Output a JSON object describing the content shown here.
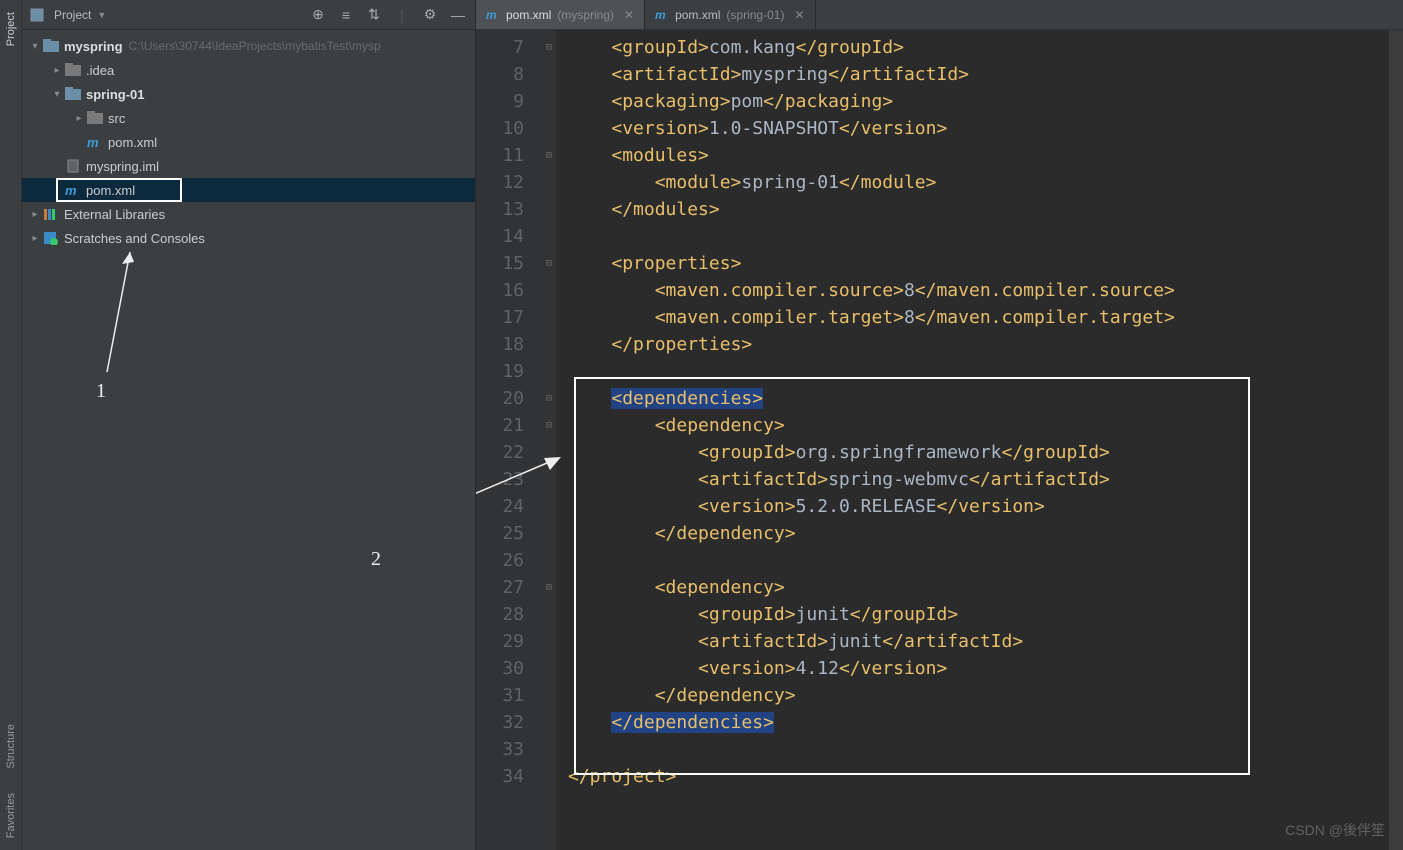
{
  "leftStripe": {
    "project": "Project",
    "structure": "Structure",
    "favorites": "Favorites"
  },
  "sidebar": {
    "title": "Project",
    "tools": {
      "add": "⊕",
      "t2": "≡",
      "t3": "⇅",
      "gear": "⚙",
      "minus": "—"
    },
    "tree": {
      "root": {
        "label": "myspring",
        "path": "C:\\Users\\30744\\IdeaProjects\\mybatisTest\\mysp"
      },
      "idea": ".idea",
      "module": "spring-01",
      "src": "src",
      "modPom": "pom.xml",
      "iml": "myspring.iml",
      "rootPom": "pom.xml",
      "ext": "External Libraries",
      "scratch": "Scratches and Consoles"
    },
    "annot1": "1"
  },
  "tabs": [
    {
      "file": "pom.xml",
      "ctx": "(myspring)",
      "active": true
    },
    {
      "file": "pom.xml",
      "ctx": "(spring-01)",
      "active": false
    }
  ],
  "annot2": "2",
  "watermark": "CSDN @後伴笙",
  "code": {
    "startLine": 7,
    "lines": [
      {
        "n": 7,
        "fold": "-",
        "ind": 1,
        "seg": [
          [
            "t",
            "<groupId>"
          ],
          [
            "x",
            "com.kang"
          ],
          [
            "t",
            "</groupId>"
          ]
        ]
      },
      {
        "n": 8,
        "fold": "",
        "ind": 1,
        "seg": [
          [
            "t",
            "<artifactId>"
          ],
          [
            "x",
            "myspring"
          ],
          [
            "t",
            "</artifactId>"
          ]
        ]
      },
      {
        "n": 9,
        "fold": "",
        "ind": 1,
        "seg": [
          [
            "t",
            "<packaging>"
          ],
          [
            "x",
            "pom"
          ],
          [
            "t",
            "</packaging>"
          ]
        ]
      },
      {
        "n": 10,
        "fold": "",
        "ind": 1,
        "seg": [
          [
            "t",
            "<version>"
          ],
          [
            "x",
            "1.0-SNAPSHOT"
          ],
          [
            "t",
            "</version>"
          ]
        ]
      },
      {
        "n": 11,
        "fold": "-",
        "ind": 1,
        "seg": [
          [
            "t",
            "<modules>"
          ]
        ]
      },
      {
        "n": 12,
        "fold": "",
        "ind": 2,
        "seg": [
          [
            "t",
            "<module>"
          ],
          [
            "x",
            "spring-01"
          ],
          [
            "t",
            "</module>"
          ]
        ]
      },
      {
        "n": 13,
        "fold": "",
        "ind": 1,
        "seg": [
          [
            "t",
            "</modules>"
          ]
        ]
      },
      {
        "n": 14,
        "fold": "",
        "ind": 0,
        "seg": []
      },
      {
        "n": 15,
        "fold": "-",
        "ind": 1,
        "seg": [
          [
            "t",
            "<properties>"
          ]
        ]
      },
      {
        "n": 16,
        "fold": "",
        "ind": 2,
        "seg": [
          [
            "t",
            "<maven.compiler.source>"
          ],
          [
            "x",
            "8"
          ],
          [
            "t",
            "</maven.compiler.source>"
          ]
        ]
      },
      {
        "n": 17,
        "fold": "",
        "ind": 2,
        "seg": [
          [
            "t",
            "<maven.compiler.target>"
          ],
          [
            "x",
            "8"
          ],
          [
            "t",
            "</maven.compiler.target>"
          ]
        ]
      },
      {
        "n": 18,
        "fold": "",
        "ind": 1,
        "seg": [
          [
            "t",
            "</properties>"
          ]
        ]
      },
      {
        "n": 19,
        "fold": "",
        "ind": 0,
        "seg": []
      },
      {
        "n": 20,
        "fold": "-",
        "ind": 1,
        "seg": [
          [
            "th",
            "<dependencies>"
          ]
        ]
      },
      {
        "n": 21,
        "fold": "-",
        "ind": 2,
        "seg": [
          [
            "t",
            "<dependency>"
          ]
        ]
      },
      {
        "n": 22,
        "fold": "",
        "ind": 3,
        "seg": [
          [
            "t",
            "<groupId>"
          ],
          [
            "x",
            "org.springframework"
          ],
          [
            "t",
            "</groupId>"
          ]
        ]
      },
      {
        "n": 23,
        "fold": "",
        "ind": 3,
        "seg": [
          [
            "t",
            "<artifactId>"
          ],
          [
            "x",
            "spring-webmvc"
          ],
          [
            "t",
            "</artifactId>"
          ]
        ]
      },
      {
        "n": 24,
        "fold": "",
        "ind": 3,
        "seg": [
          [
            "t",
            "<version>"
          ],
          [
            "x",
            "5.2.0.RELEASE"
          ],
          [
            "t",
            "</version>"
          ]
        ]
      },
      {
        "n": 25,
        "fold": "",
        "ind": 2,
        "seg": [
          [
            "t",
            "</dependency>"
          ]
        ]
      },
      {
        "n": 26,
        "fold": "",
        "ind": 0,
        "seg": []
      },
      {
        "n": 27,
        "fold": "-",
        "ind": 2,
        "seg": [
          [
            "t",
            "<dependency>"
          ]
        ]
      },
      {
        "n": 28,
        "fold": "",
        "ind": 3,
        "seg": [
          [
            "t",
            "<groupId>"
          ],
          [
            "x",
            "junit"
          ],
          [
            "t",
            "</groupId>"
          ]
        ]
      },
      {
        "n": 29,
        "fold": "",
        "ind": 3,
        "seg": [
          [
            "t",
            "<artifactId>"
          ],
          [
            "x",
            "junit"
          ],
          [
            "t",
            "</artifactId>"
          ]
        ]
      },
      {
        "n": 30,
        "fold": "",
        "ind": 3,
        "seg": [
          [
            "t",
            "<version>"
          ],
          [
            "x",
            "4.12"
          ],
          [
            "t",
            "</version>"
          ]
        ]
      },
      {
        "n": 31,
        "fold": "",
        "ind": 2,
        "seg": [
          [
            "t",
            "</dependency>"
          ]
        ]
      },
      {
        "n": 32,
        "fold": "",
        "ind": 1,
        "seg": [
          [
            "th",
            "</dependencies>"
          ]
        ]
      },
      {
        "n": 33,
        "fold": "",
        "ind": 0,
        "seg": []
      },
      {
        "n": 34,
        "fold": "",
        "ind": 0,
        "seg": [
          [
            "t",
            "</project>"
          ]
        ]
      }
    ]
  }
}
